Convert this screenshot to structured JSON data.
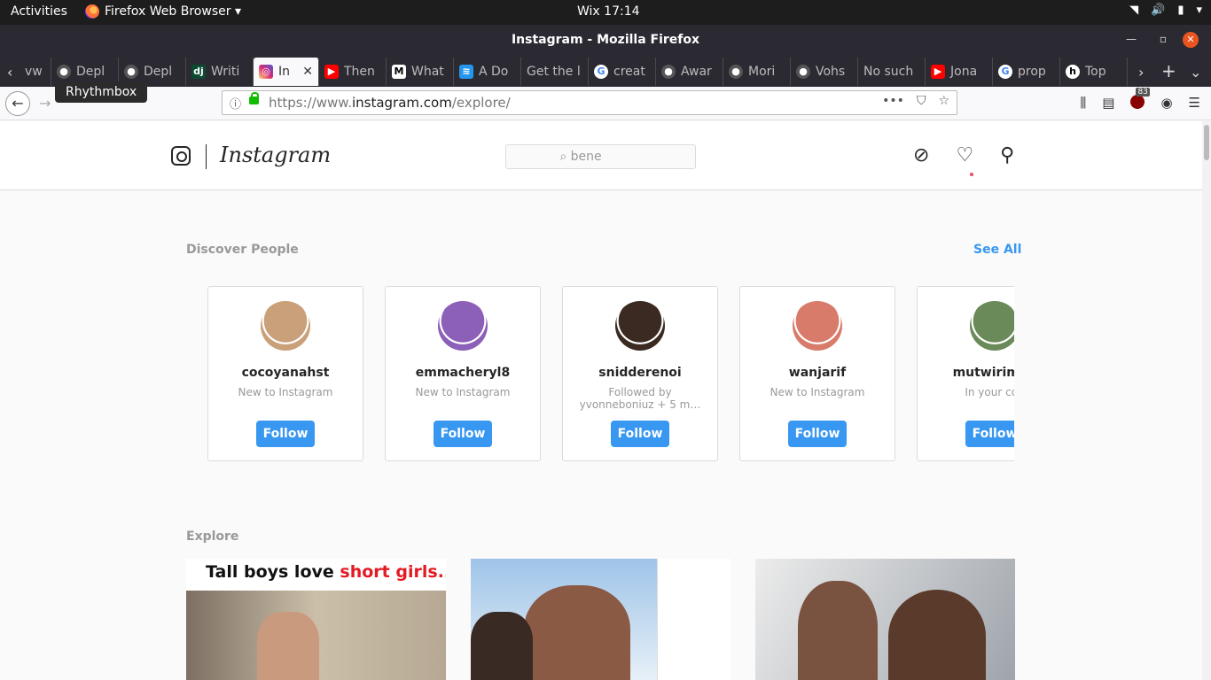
{
  "system_bar": {
    "activities": "Activities",
    "app_menu": "Firefox Web Browser ▾",
    "clock": "Wix 17:14"
  },
  "window": {
    "title": "Instagram - Mozilla Firefox"
  },
  "tabs": [
    {
      "label": "vw",
      "icon": "none"
    },
    {
      "label": "Depl",
      "icon": "github-icon"
    },
    {
      "label": "Depl",
      "icon": "github-icon"
    },
    {
      "label": "Writi",
      "icon": "django-icon"
    },
    {
      "label": "In",
      "icon": "instagram-icon",
      "active": true
    },
    {
      "label": "Then",
      "icon": "youtube-icon"
    },
    {
      "label": "What",
      "icon": "medium-icon"
    },
    {
      "label": "A Do",
      "icon": "docker-icon"
    },
    {
      "label": "Get the l",
      "icon": "none"
    },
    {
      "label": "creat",
      "icon": "google-icon"
    },
    {
      "label": "Awar",
      "icon": "github-icon"
    },
    {
      "label": "Mori",
      "icon": "github-icon"
    },
    {
      "label": "Vohs",
      "icon": "github-icon"
    },
    {
      "label": "No such",
      "icon": "none"
    },
    {
      "label": "Jona",
      "icon": "youtube-icon"
    },
    {
      "label": "prop",
      "icon": "google-icon"
    },
    {
      "label": "Top",
      "icon": "top-icon"
    }
  ],
  "tooltip": "Rhythmbox",
  "urlbar": {
    "prefix": "https://www.",
    "domain": "instagram.com",
    "path": "/explore/",
    "badge_count": "83"
  },
  "instagram": {
    "wordmark": "Instagram",
    "search_value": "bene",
    "discover_title": "Discover People",
    "see_all": "See All",
    "explore_title": "Explore",
    "follow_label": "Follow",
    "people": [
      {
        "username": "cocoyanahst",
        "subtitle": "New to Instagram",
        "avatar_color": "#c9a07a"
      },
      {
        "username": "emmacheryl8",
        "subtitle": "New to Instagram",
        "avatar_color": "#8c5fb8"
      },
      {
        "username": "snidderenoi",
        "subtitle": "Followed by yvonneboniuz + 5 m…",
        "avatar_color": "#3a2a22"
      },
      {
        "username": "wanjarif",
        "subtitle": "New to Instagram",
        "avatar_color": "#d97b6a"
      },
      {
        "username": "mutwirimoh",
        "subtitle": "In your con",
        "avatar_color": "#6b8a5a"
      }
    ],
    "explore_posts": [
      {
        "caption_black": "Tall boys love ",
        "caption_red": "short girls.."
      },
      {
        "caption_black": "",
        "caption_red": ""
      },
      {
        "caption_black": "",
        "caption_red": ""
      }
    ]
  },
  "colors": {
    "accent": "#3897f0",
    "heart_dot": "#ed4956"
  }
}
